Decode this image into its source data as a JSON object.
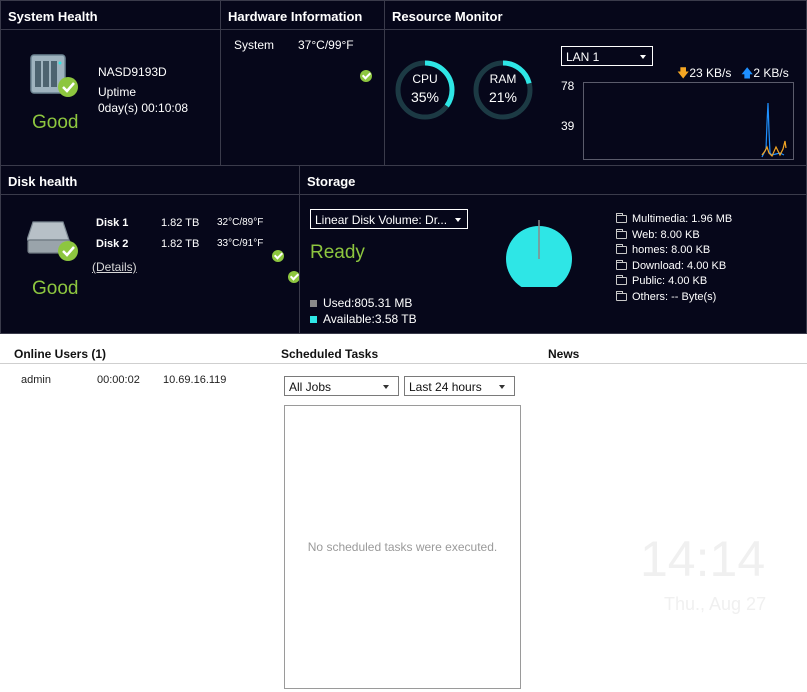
{
  "system_health": {
    "title": "System Health",
    "device_name": "NASD9193D",
    "uptime_label": "Uptime",
    "uptime_value": "0day(s) 00:10:08",
    "status": "Good"
  },
  "hardware": {
    "title": "Hardware Information",
    "rows": [
      {
        "label": "System",
        "value": "37°C/99°F"
      }
    ]
  },
  "resource_monitor": {
    "title": "Resource Monitor",
    "cpu": {
      "label": "CPU",
      "value": "35%",
      "percent": 35
    },
    "ram": {
      "label": "RAM",
      "value": "21%",
      "percent": 21
    },
    "lan_select": "LAN 1",
    "download_speed": "23 KB/s",
    "upload_speed": "2 KB/s",
    "y_ticks": [
      "78",
      "39"
    ],
    "colors": {
      "ring": "#2ee6e6",
      "download": "#f5a623",
      "upload": "#1e90ff"
    }
  },
  "disk_health": {
    "title": "Disk health",
    "disks": [
      {
        "name": "Disk 1",
        "size": "1.82 TB",
        "temp": "32°C/89°F"
      },
      {
        "name": "Disk 2",
        "size": "1.82 TB",
        "temp": "33°C/91°F"
      }
    ],
    "details_link": "(Details)",
    "status": "Good"
  },
  "storage": {
    "title": "Storage",
    "volume_select": "Linear Disk Volume: Dr...",
    "status": "Ready",
    "used": "Used:805.31 MB",
    "available": "Available:3.58 TB",
    "folders": [
      "Multimedia: 1.96 MB",
      "Web: 8.00 KB",
      "homes: 8.00 KB",
      "Download: 4.00 KB",
      "Public: 4.00 KB",
      "Others: -- Byte(s)"
    ],
    "colors": {
      "used": "#8a8a8a",
      "available": "#2ee6e6"
    }
  },
  "online_users": {
    "title": "Online Users (1)",
    "rows": [
      {
        "user": "admin",
        "time": "00:00:02",
        "ip": "10.69.16.119"
      }
    ]
  },
  "scheduled_tasks": {
    "title": "Scheduled Tasks",
    "job_filter": "All Jobs",
    "time_filter": "Last 24 hours",
    "empty_message": "No scheduled tasks were executed."
  },
  "news": {
    "title": "News"
  },
  "clock": {
    "time": "14:14",
    "date": "Thu., Aug 27"
  }
}
